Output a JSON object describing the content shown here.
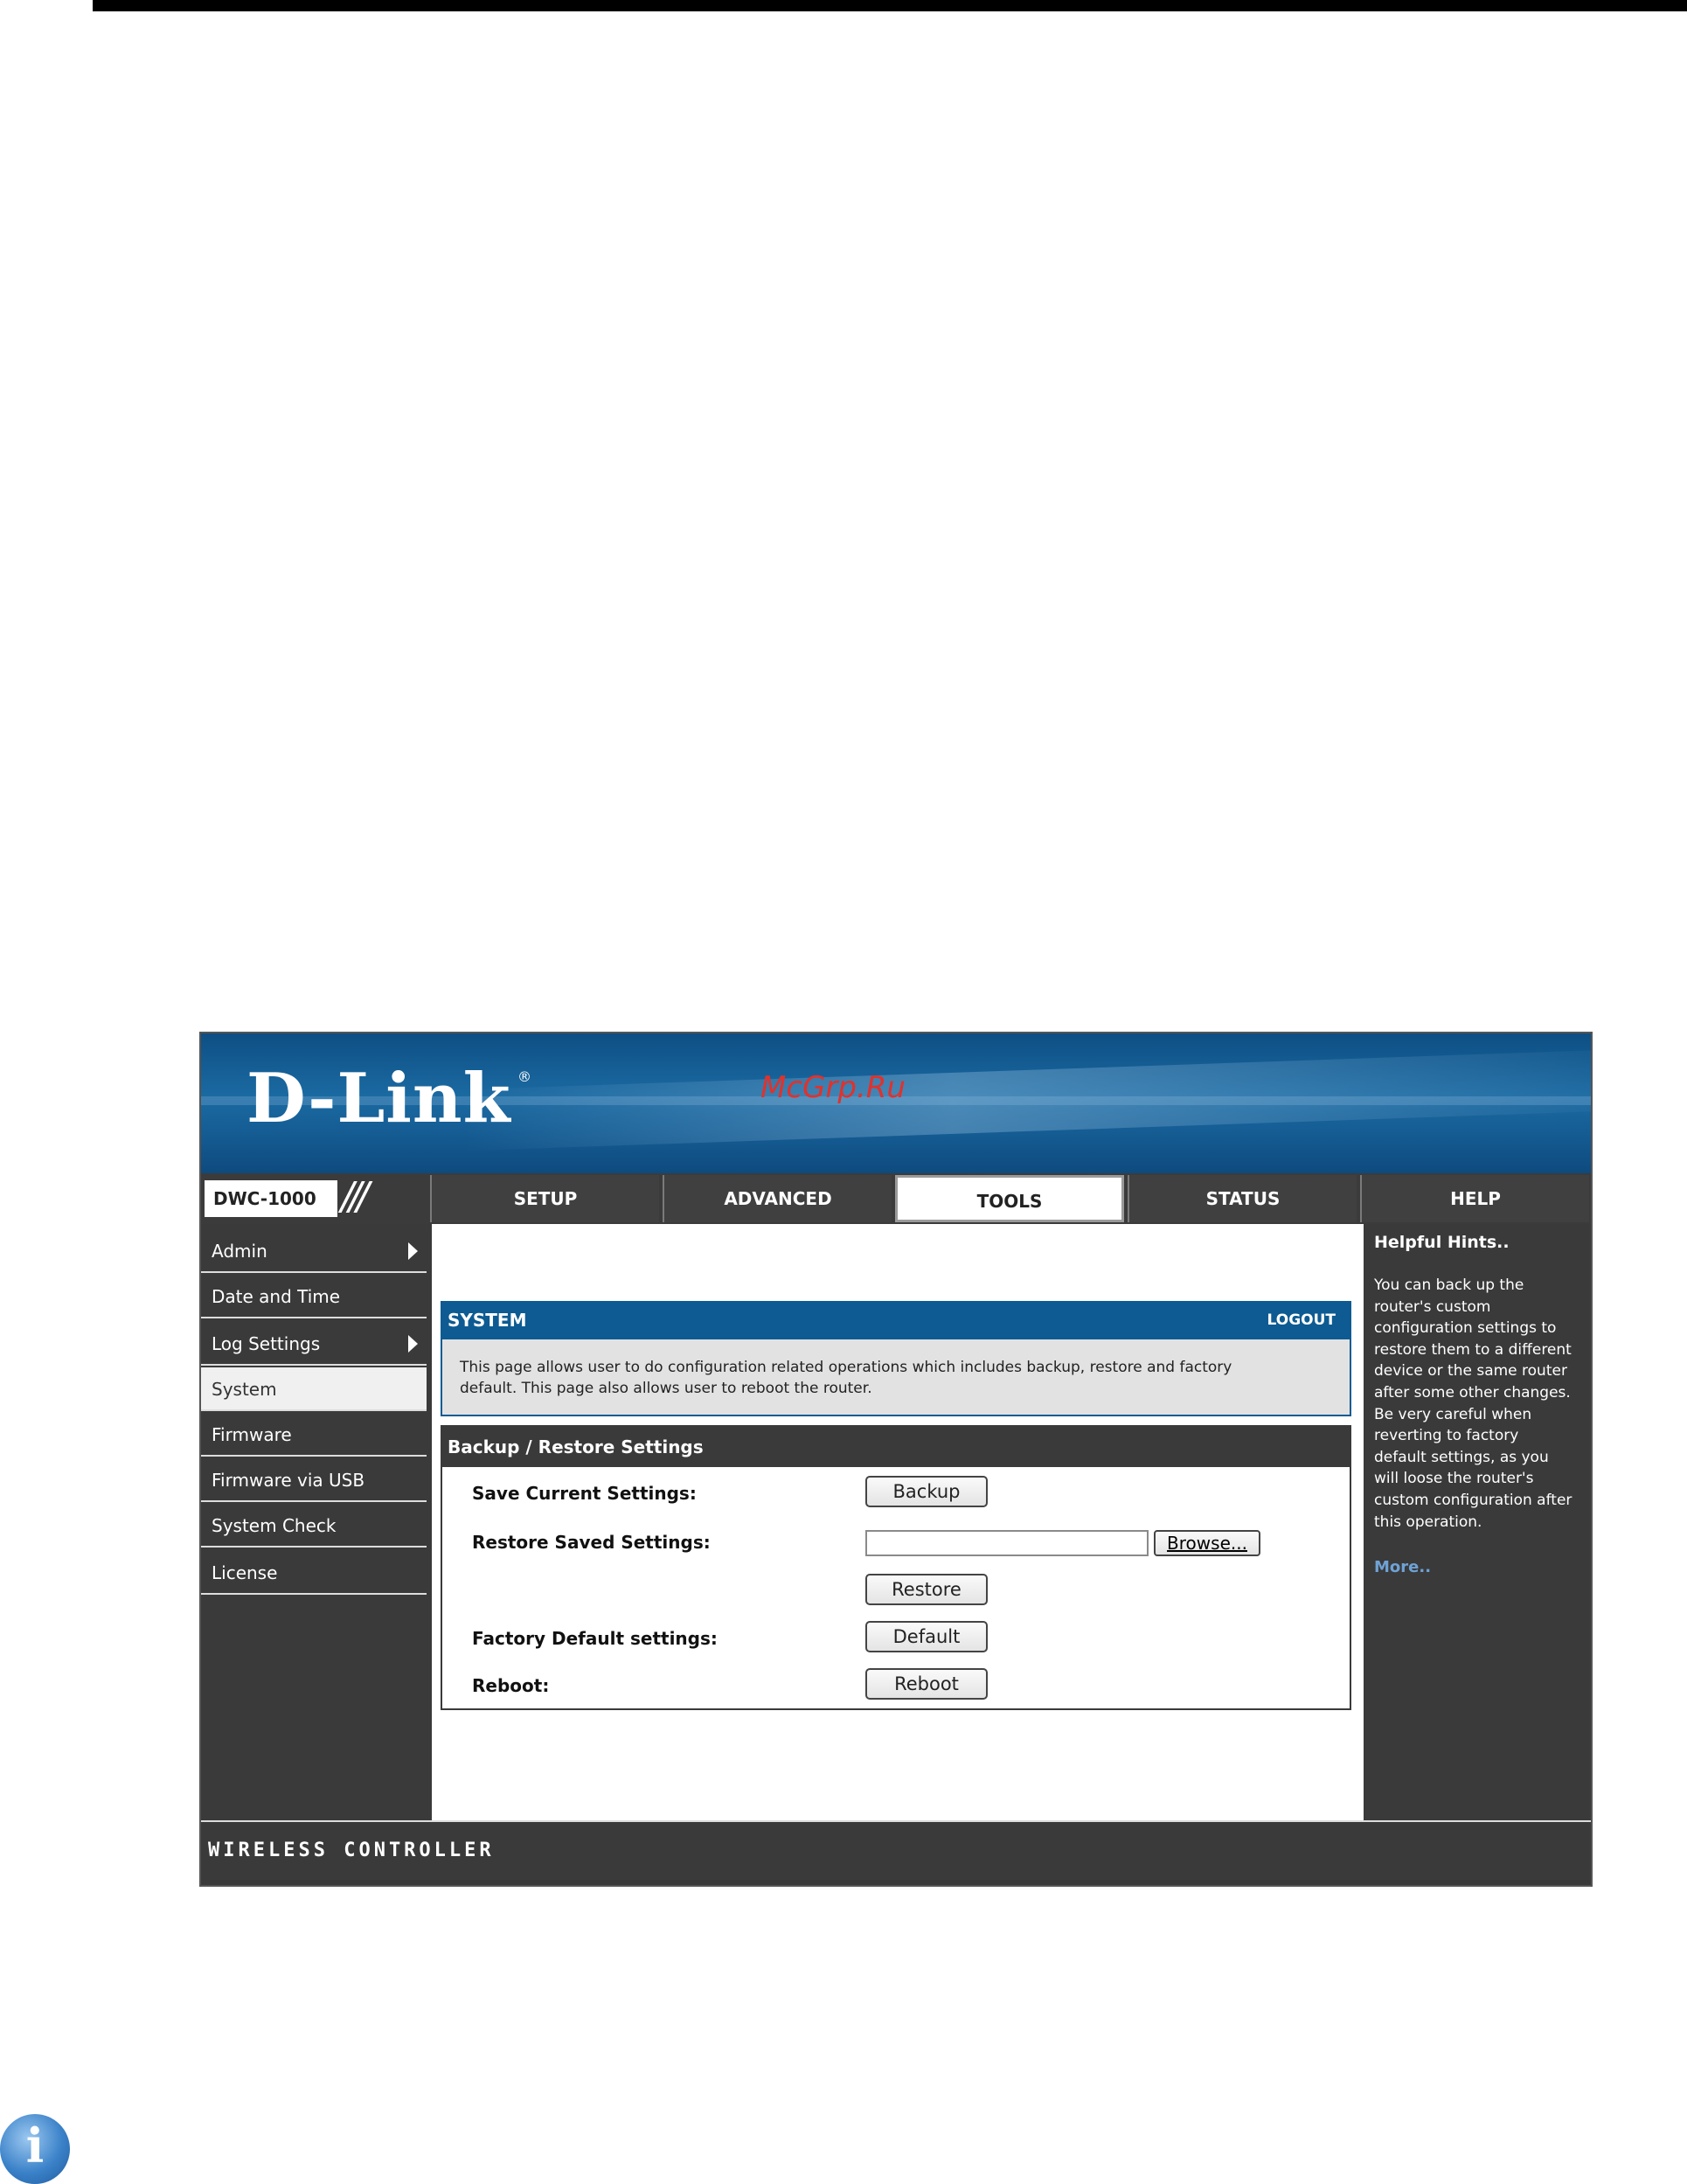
{
  "brand": {
    "logo": "D-Link",
    "registered": "®",
    "watermark": "McGrp.Ru"
  },
  "model": "DWC-1000",
  "tabs": [
    "SETUP",
    "ADVANCED",
    "TOOLS",
    "STATUS",
    "HELP"
  ],
  "active_tab": "TOOLS",
  "sidebar": {
    "items": [
      {
        "label": "Admin"
      },
      {
        "label": "Date and Time"
      },
      {
        "label": "Log Settings"
      },
      {
        "label": "System"
      },
      {
        "label": "Firmware"
      },
      {
        "label": "Firmware via USB"
      },
      {
        "label": "System Check"
      },
      {
        "label": "License"
      }
    ],
    "active": "System"
  },
  "system": {
    "title": "SYSTEM",
    "logout": "LOGOUT",
    "description_line1": "This page allows user to do configuration related operations which includes backup, restore and factory",
    "description_line2": "default. This page also allows user to reboot the router."
  },
  "backup_section": {
    "title": "Backup / Restore Settings",
    "save_label": "Save Current Settings:",
    "backup_button": "Backup",
    "restore_label": "Restore Saved Settings:",
    "browse_button": "Browse...",
    "restore_button": "Restore",
    "factory_label": "Factory Default settings:",
    "default_button": "Default",
    "reboot_label": "Reboot:",
    "reboot_button": "Reboot"
  },
  "help": {
    "title": "Helpful Hints..",
    "lines": [
      "You can back up the",
      "router's custom",
      "configuration settings to",
      "restore them to a different",
      "device or the same router",
      "after some other changes.",
      "Be very careful when",
      "reverting to factory",
      "default settings, as you",
      "will loose the router's",
      "custom configuration after",
      "this operation."
    ],
    "more": "More.."
  },
  "footer": "WIRELESS CONTROLLER",
  "icons": {
    "info": "info-icon"
  }
}
